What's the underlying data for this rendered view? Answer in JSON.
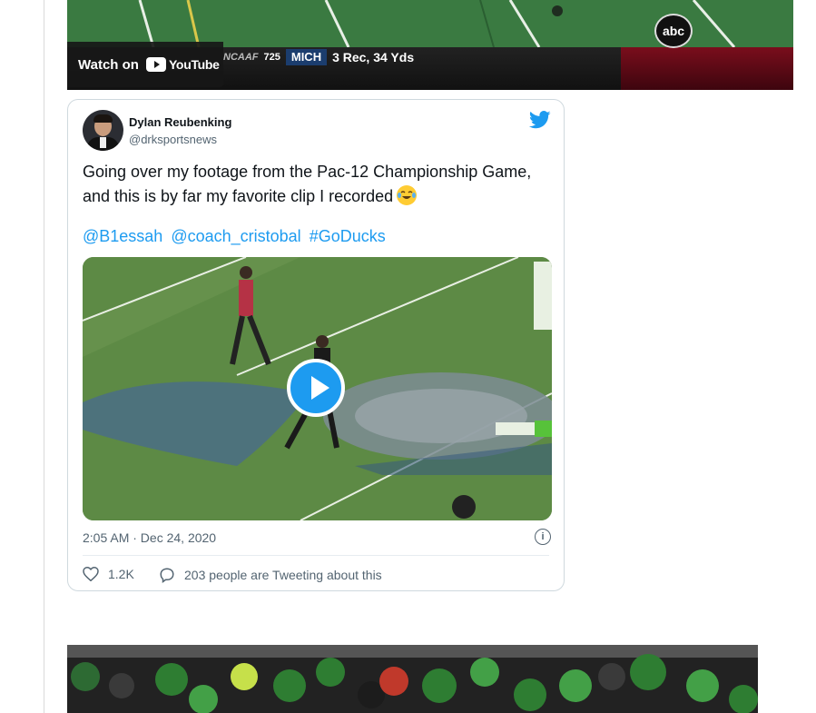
{
  "youtube_embed": {
    "watch_label": "Watch on",
    "youtube_label": "YouTube",
    "scorebug": {
      "league": "NCAAF",
      "rank": "725",
      "team": "MICH",
      "stat": "3 Rec, 34 Yds"
    },
    "network_logo": "abc"
  },
  "tweet": {
    "author_name": "Dylan Reubenking",
    "author_handle": "@drksportsnews",
    "text": "Going over my footage from the Pac-12 Championship Game, and this is by far my favorite clip I recorded",
    "emoji": "tears-of-joy-emoji",
    "mentions": [
      "@B1essah",
      "@coach_cristobal",
      "#GoDucks"
    ],
    "timestamp": "2:05 AM · Dec 24, 2020",
    "like_count": "1.2K",
    "reply_text": "203 people are Tweeting about this",
    "icons": {
      "brand": "twitter-bird-icon",
      "play": "play-icon",
      "info": "info-icon",
      "like": "heart-icon",
      "reply": "comment-icon"
    },
    "accent_color": "#1d9bf0"
  },
  "bottom_image": {
    "description_icon": "team-photo-image"
  }
}
